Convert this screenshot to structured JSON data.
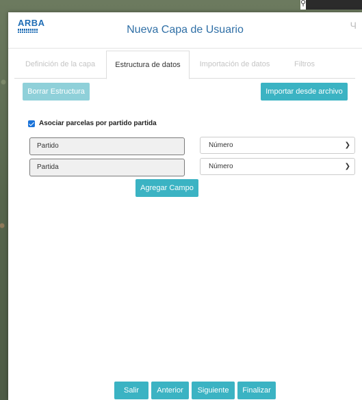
{
  "dialog": {
    "logo_text": "ARBA",
    "title": "Nueva Capa de Usuario",
    "tabs": [
      {
        "label": "Definición de la capa",
        "active": false
      },
      {
        "label": "Estructura de datos",
        "active": true
      },
      {
        "label": "Importación de datos",
        "active": false
      },
      {
        "label": "Filtros",
        "active": false
      }
    ],
    "toolbar": {
      "clear_label": "Borrar Estructura",
      "import_label": "Importar desde archivo"
    },
    "checkbox": {
      "label": "Asociar parcelas por partido partida",
      "checked": true
    },
    "fields": [
      {
        "name": "Partido",
        "type": "Número"
      },
      {
        "name": "Partida",
        "type": "Número"
      }
    ],
    "add_field_label": "Agregar Campo",
    "footer": {
      "exit": "Salir",
      "prev": "Anterior",
      "next": "Siguiente",
      "finish": "Finalizar"
    }
  },
  "colors": {
    "accent": "#3bb3c3",
    "accent_disabled": "#8fd0d9",
    "title": "#2f6fa6",
    "brand": "#1f6db5"
  }
}
